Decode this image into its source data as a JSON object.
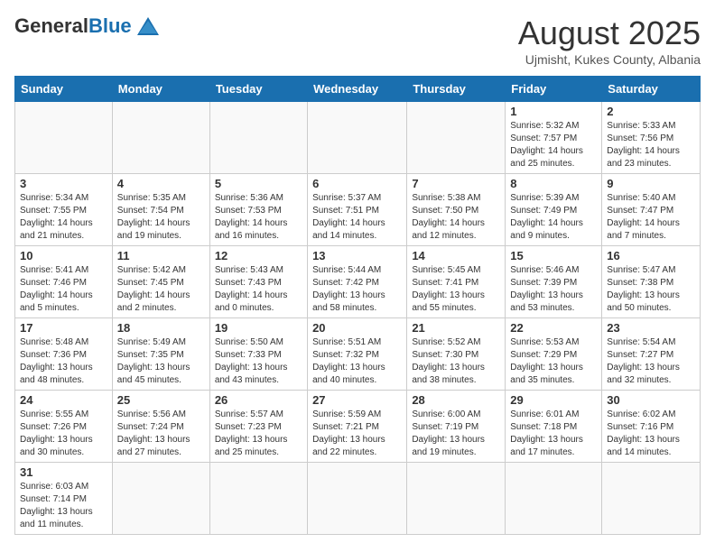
{
  "header": {
    "logo_general": "General",
    "logo_blue": "Blue",
    "month_year": "August 2025",
    "location": "Ujmisht, Kukes County, Albania"
  },
  "days_of_week": [
    "Sunday",
    "Monday",
    "Tuesday",
    "Wednesday",
    "Thursday",
    "Friday",
    "Saturday"
  ],
  "weeks": [
    {
      "days": [
        {
          "number": "",
          "info": ""
        },
        {
          "number": "",
          "info": ""
        },
        {
          "number": "",
          "info": ""
        },
        {
          "number": "",
          "info": ""
        },
        {
          "number": "",
          "info": ""
        },
        {
          "number": "1",
          "info": "Sunrise: 5:32 AM\nSunset: 7:57 PM\nDaylight: 14 hours and 25 minutes."
        },
        {
          "number": "2",
          "info": "Sunrise: 5:33 AM\nSunset: 7:56 PM\nDaylight: 14 hours and 23 minutes."
        }
      ]
    },
    {
      "days": [
        {
          "number": "3",
          "info": "Sunrise: 5:34 AM\nSunset: 7:55 PM\nDaylight: 14 hours and 21 minutes."
        },
        {
          "number": "4",
          "info": "Sunrise: 5:35 AM\nSunset: 7:54 PM\nDaylight: 14 hours and 19 minutes."
        },
        {
          "number": "5",
          "info": "Sunrise: 5:36 AM\nSunset: 7:53 PM\nDaylight: 14 hours and 16 minutes."
        },
        {
          "number": "6",
          "info": "Sunrise: 5:37 AM\nSunset: 7:51 PM\nDaylight: 14 hours and 14 minutes."
        },
        {
          "number": "7",
          "info": "Sunrise: 5:38 AM\nSunset: 7:50 PM\nDaylight: 14 hours and 12 minutes."
        },
        {
          "number": "8",
          "info": "Sunrise: 5:39 AM\nSunset: 7:49 PM\nDaylight: 14 hours and 9 minutes."
        },
        {
          "number": "9",
          "info": "Sunrise: 5:40 AM\nSunset: 7:47 PM\nDaylight: 14 hours and 7 minutes."
        }
      ]
    },
    {
      "days": [
        {
          "number": "10",
          "info": "Sunrise: 5:41 AM\nSunset: 7:46 PM\nDaylight: 14 hours and 5 minutes."
        },
        {
          "number": "11",
          "info": "Sunrise: 5:42 AM\nSunset: 7:45 PM\nDaylight: 14 hours and 2 minutes."
        },
        {
          "number": "12",
          "info": "Sunrise: 5:43 AM\nSunset: 7:43 PM\nDaylight: 14 hours and 0 minutes."
        },
        {
          "number": "13",
          "info": "Sunrise: 5:44 AM\nSunset: 7:42 PM\nDaylight: 13 hours and 58 minutes."
        },
        {
          "number": "14",
          "info": "Sunrise: 5:45 AM\nSunset: 7:41 PM\nDaylight: 13 hours and 55 minutes."
        },
        {
          "number": "15",
          "info": "Sunrise: 5:46 AM\nSunset: 7:39 PM\nDaylight: 13 hours and 53 minutes."
        },
        {
          "number": "16",
          "info": "Sunrise: 5:47 AM\nSunset: 7:38 PM\nDaylight: 13 hours and 50 minutes."
        }
      ]
    },
    {
      "days": [
        {
          "number": "17",
          "info": "Sunrise: 5:48 AM\nSunset: 7:36 PM\nDaylight: 13 hours and 48 minutes."
        },
        {
          "number": "18",
          "info": "Sunrise: 5:49 AM\nSunset: 7:35 PM\nDaylight: 13 hours and 45 minutes."
        },
        {
          "number": "19",
          "info": "Sunrise: 5:50 AM\nSunset: 7:33 PM\nDaylight: 13 hours and 43 minutes."
        },
        {
          "number": "20",
          "info": "Sunrise: 5:51 AM\nSunset: 7:32 PM\nDaylight: 13 hours and 40 minutes."
        },
        {
          "number": "21",
          "info": "Sunrise: 5:52 AM\nSunset: 7:30 PM\nDaylight: 13 hours and 38 minutes."
        },
        {
          "number": "22",
          "info": "Sunrise: 5:53 AM\nSunset: 7:29 PM\nDaylight: 13 hours and 35 minutes."
        },
        {
          "number": "23",
          "info": "Sunrise: 5:54 AM\nSunset: 7:27 PM\nDaylight: 13 hours and 32 minutes."
        }
      ]
    },
    {
      "days": [
        {
          "number": "24",
          "info": "Sunrise: 5:55 AM\nSunset: 7:26 PM\nDaylight: 13 hours and 30 minutes."
        },
        {
          "number": "25",
          "info": "Sunrise: 5:56 AM\nSunset: 7:24 PM\nDaylight: 13 hours and 27 minutes."
        },
        {
          "number": "26",
          "info": "Sunrise: 5:57 AM\nSunset: 7:23 PM\nDaylight: 13 hours and 25 minutes."
        },
        {
          "number": "27",
          "info": "Sunrise: 5:59 AM\nSunset: 7:21 PM\nDaylight: 13 hours and 22 minutes."
        },
        {
          "number": "28",
          "info": "Sunrise: 6:00 AM\nSunset: 7:19 PM\nDaylight: 13 hours and 19 minutes."
        },
        {
          "number": "29",
          "info": "Sunrise: 6:01 AM\nSunset: 7:18 PM\nDaylight: 13 hours and 17 minutes."
        },
        {
          "number": "30",
          "info": "Sunrise: 6:02 AM\nSunset: 7:16 PM\nDaylight: 13 hours and 14 minutes."
        }
      ]
    },
    {
      "days": [
        {
          "number": "31",
          "info": "Sunrise: 6:03 AM\nSunset: 7:14 PM\nDaylight: 13 hours and 11 minutes."
        },
        {
          "number": "",
          "info": ""
        },
        {
          "number": "",
          "info": ""
        },
        {
          "number": "",
          "info": ""
        },
        {
          "number": "",
          "info": ""
        },
        {
          "number": "",
          "info": ""
        },
        {
          "number": "",
          "info": ""
        }
      ]
    }
  ]
}
